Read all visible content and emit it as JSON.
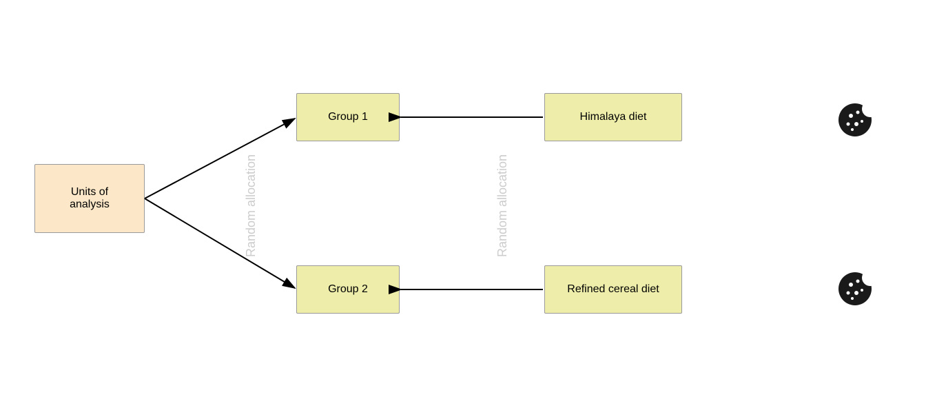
{
  "boxes": {
    "units_label": "Units of\nanalysis",
    "group1_label": "Group 1",
    "group2_label": "Group 2",
    "himalaya_label": "Himalaya diet",
    "refined_label": "Refined cereal diet"
  },
  "labels": {
    "random_allocation_1": "Random allocation",
    "random_allocation_2": "Random allocation"
  },
  "icons": {
    "cookie1": "🍪",
    "cookie2": "🍪"
  }
}
